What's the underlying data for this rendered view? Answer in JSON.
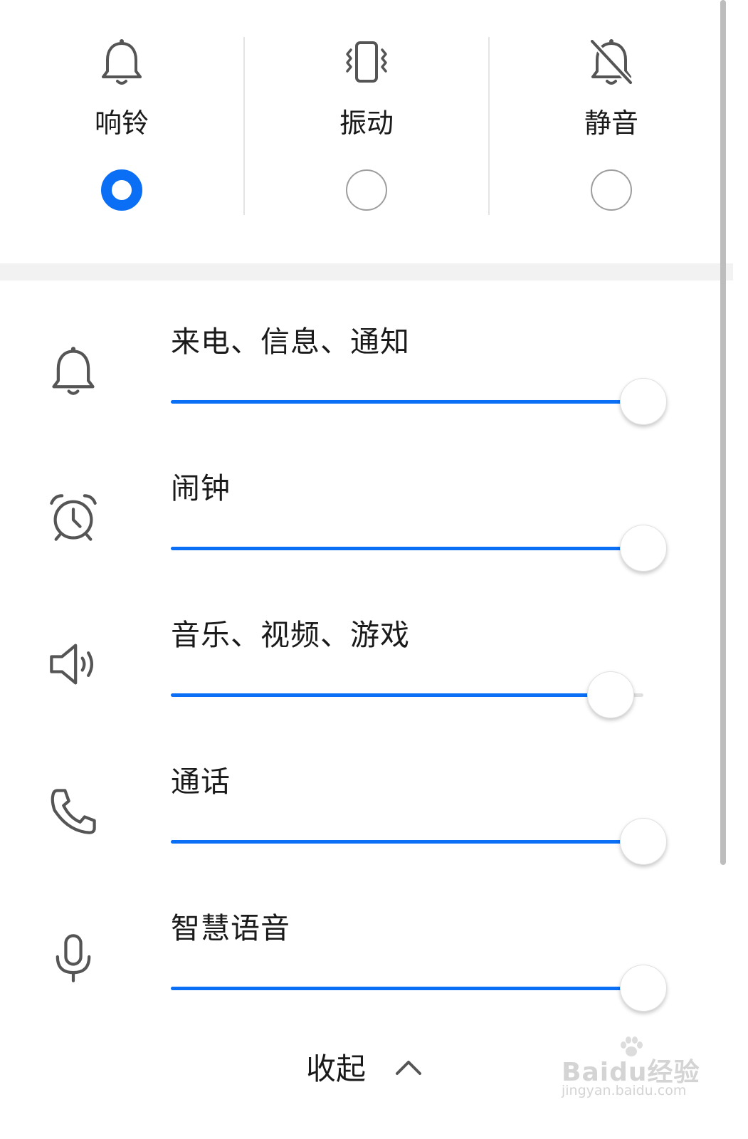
{
  "modes": [
    {
      "id": "ring",
      "label": "响铃",
      "icon": "bell-icon",
      "selected": true
    },
    {
      "id": "vibrate",
      "label": "振动",
      "icon": "vibrate-icon",
      "selected": false
    },
    {
      "id": "silent",
      "label": "静音",
      "icon": "bell-off-icon",
      "selected": false
    }
  ],
  "volumes": [
    {
      "id": "ring",
      "label": "来电、信息、通知",
      "icon": "bell-icon",
      "level": 1.0
    },
    {
      "id": "alarm",
      "label": "闹钟",
      "icon": "alarm-clock-icon",
      "level": 1.0
    },
    {
      "id": "media",
      "label": "音乐、视频、游戏",
      "icon": "speaker-icon",
      "level": 0.93
    },
    {
      "id": "call",
      "label": "通话",
      "icon": "phone-icon",
      "level": 1.0
    },
    {
      "id": "assistant",
      "label": "智慧语音",
      "icon": "microphone-icon",
      "level": 1.0
    }
  ],
  "collapse": {
    "label": "收起",
    "icon": "chevron-up-icon"
  },
  "watermark": {
    "main": "Baidu经验",
    "sub": "jingyan.baidu.com"
  },
  "colors": {
    "accent": "#0a6ff5",
    "icon": "#555555",
    "divider": "#e4e4e4",
    "band": "#f2f2f2"
  }
}
